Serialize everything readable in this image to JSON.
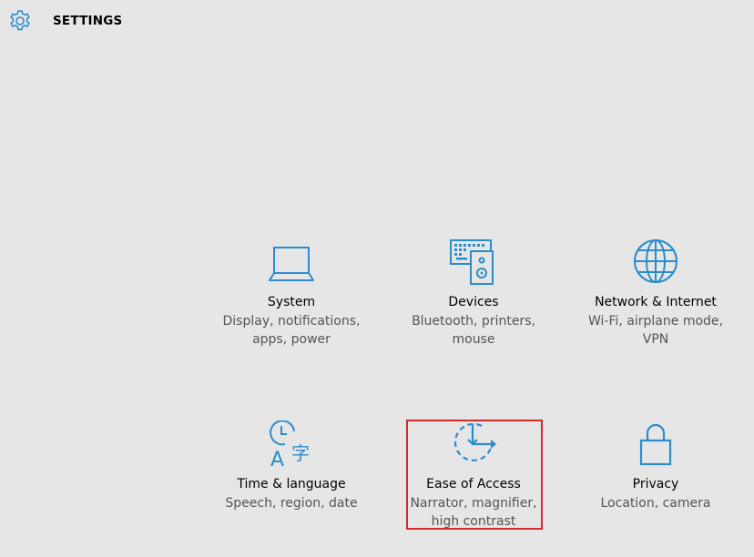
{
  "header": {
    "title": "SETTINGS",
    "icon": "gear-icon"
  },
  "accent_color": "#2b8ccf",
  "tiles": [
    {
      "id": "system",
      "icon": "laptop-icon",
      "name": "System",
      "desc": [
        "Display, notifications,",
        "apps, power"
      ]
    },
    {
      "id": "devices",
      "icon": "devices-icon",
      "name": "Devices",
      "desc": [
        "Bluetooth, printers,",
        "mouse"
      ]
    },
    {
      "id": "network",
      "icon": "globe-icon",
      "name": "Network & Internet",
      "desc": [
        "Wi-Fi, airplane mode,",
        "VPN"
      ]
    },
    {
      "id": "time",
      "icon": "time-language-icon",
      "name": "Time & language",
      "desc": [
        "Speech, region, date"
      ]
    },
    {
      "id": "ease",
      "icon": "ease-of-access-icon",
      "name": "Ease of Access",
      "desc": [
        "Narrator, magnifier,",
        "high contrast"
      ],
      "highlighted": true
    },
    {
      "id": "privacy",
      "icon": "lock-icon",
      "name": "Privacy",
      "desc": [
        "Location, camera"
      ]
    }
  ]
}
